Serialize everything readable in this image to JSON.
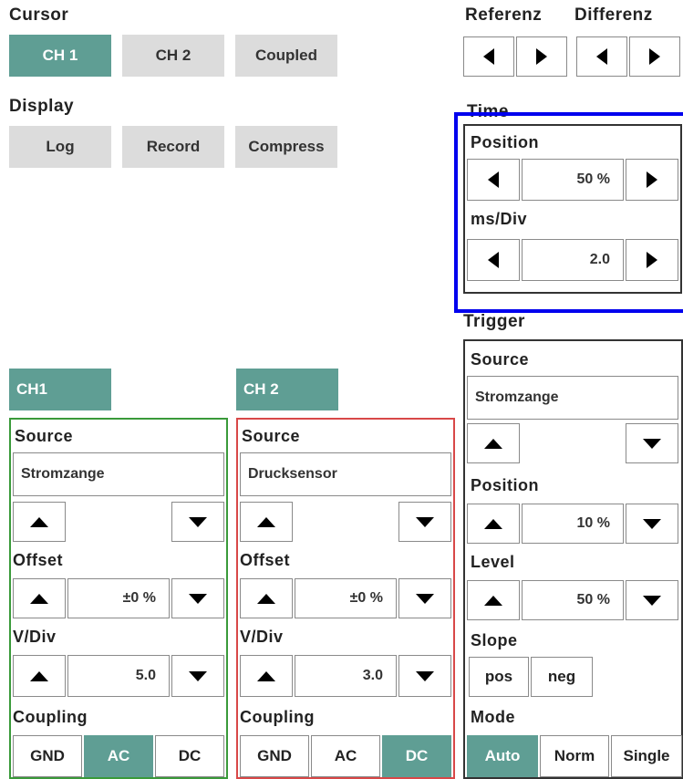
{
  "cursor": {
    "label": "Cursor",
    "buttons": [
      "CH 1",
      "CH 2",
      "Coupled"
    ],
    "active": "CH 1"
  },
  "display": {
    "label": "Display",
    "buttons": [
      "Log",
      "Record",
      "Compress"
    ]
  },
  "referenz": {
    "label": "Referenz"
  },
  "differenz": {
    "label": "Differenz"
  },
  "time": {
    "label": "Time",
    "position_label": "Position",
    "position_value": "50 %",
    "msdiv_label": "ms/Div",
    "msdiv_value": "2.0"
  },
  "trigger": {
    "label": "Trigger",
    "source_label": "Source",
    "source_value": "Stromzange",
    "position_label": "Position",
    "position_value": "10 %",
    "level_label": "Level",
    "level_value": "50 %",
    "slope_label": "Slope",
    "slope_buttons": [
      "pos",
      "neg"
    ],
    "mode_label": "Mode",
    "mode_buttons": [
      "Auto",
      "Norm",
      "Single"
    ],
    "mode_active": "Auto"
  },
  "ch1": {
    "tab": "CH1",
    "source_label": "Source",
    "source_value": "Stromzange",
    "offset_label": "Offset",
    "offset_value": "±0 %",
    "vdiv_label": "V/Div",
    "vdiv_value": "5.0",
    "coupling_label": "Coupling",
    "coupling_buttons": [
      "GND",
      "AC",
      "DC"
    ],
    "coupling_active": "AC"
  },
  "ch2": {
    "tab": "CH 2",
    "source_label": "Source",
    "source_value": "Drucksensor",
    "offset_label": "Offset",
    "offset_value": "±0 %",
    "vdiv_label": "V/Div",
    "vdiv_value": "3.0",
    "coupling_label": "Coupling",
    "coupling_buttons": [
      "GND",
      "AC",
      "DC"
    ],
    "coupling_active": "DC"
  },
  "colors": {
    "accent_teal": "#5f9e94",
    "ch1_border": "#3a9a3a",
    "ch2_border": "#d84848",
    "highlight_blue": "#0000ee",
    "button_gray": "#dcdcdc"
  }
}
